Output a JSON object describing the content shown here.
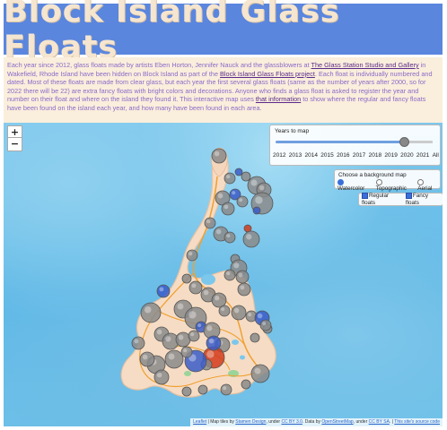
{
  "header": {
    "title": "Block Island Glass Floats"
  },
  "intro": {
    "p1": "Each year since 2012, glass floats made by artists Eben Horton, Jennifer Nauck and the glassblowers at ",
    "link1": "The Glass Station Studio and Gallery",
    "p2": " in Wakefield, Rhode Island have been hidden on Block Island as part of the ",
    "link2": "Block Island Glass Floats project",
    "p3": ". Each float is individually numbered and dated. Most of these floats are made from clear glass, but each year the first several glass floats (same as the number of years after 2000, so for 2022 there will be 22) are extra fancy floats with bright colors and decorations. Anyone who finds a glass float is asked to register the year and number on their float and where on the island they found it. This interactive map uses ",
    "link3": "that information",
    "p4": " to show where the regular and fancy floats have been found on the island each year, and how many have been found in each area."
  },
  "map": {
    "zoom_in": "+",
    "zoom_out": "−",
    "years_panel": {
      "title": "Years to map",
      "labels": [
        "2012",
        "2013",
        "2014",
        "2015",
        "2016",
        "2017",
        "2018",
        "2019",
        "2020",
        "2021",
        "All"
      ],
      "selected_fraction": 0.82
    },
    "background_panel": {
      "title": "Choose a background map",
      "options": [
        {
          "label": "Watercolor",
          "selected": true
        },
        {
          "label": "Topographic",
          "selected": false
        },
        {
          "label": "Aerial",
          "selected": false
        }
      ]
    },
    "floats_panel": {
      "regular": "Regular floats",
      "fancy": "Fancy floats"
    },
    "attribution": {
      "leaflet": "Leaflet",
      "t1": " | Map tiles by ",
      "stamen": "Stamen Design",
      "t2": ", under ",
      "ccby3": "CC BY 3.0",
      "t3": ". Data by ",
      "osm": "OpenStreetMap",
      "t4": ", under ",
      "ccbysa": "CC BY SA",
      "t5": ". | ",
      "source": "This site's source code"
    },
    "colors": {
      "water": "#6cc0e8",
      "land": "#f6dcc4",
      "road": "#f0a030",
      "regular_float": "#8a8a8a",
      "fancy_float": "#3a5cc8",
      "red_float": "#d23a1a"
    }
  }
}
